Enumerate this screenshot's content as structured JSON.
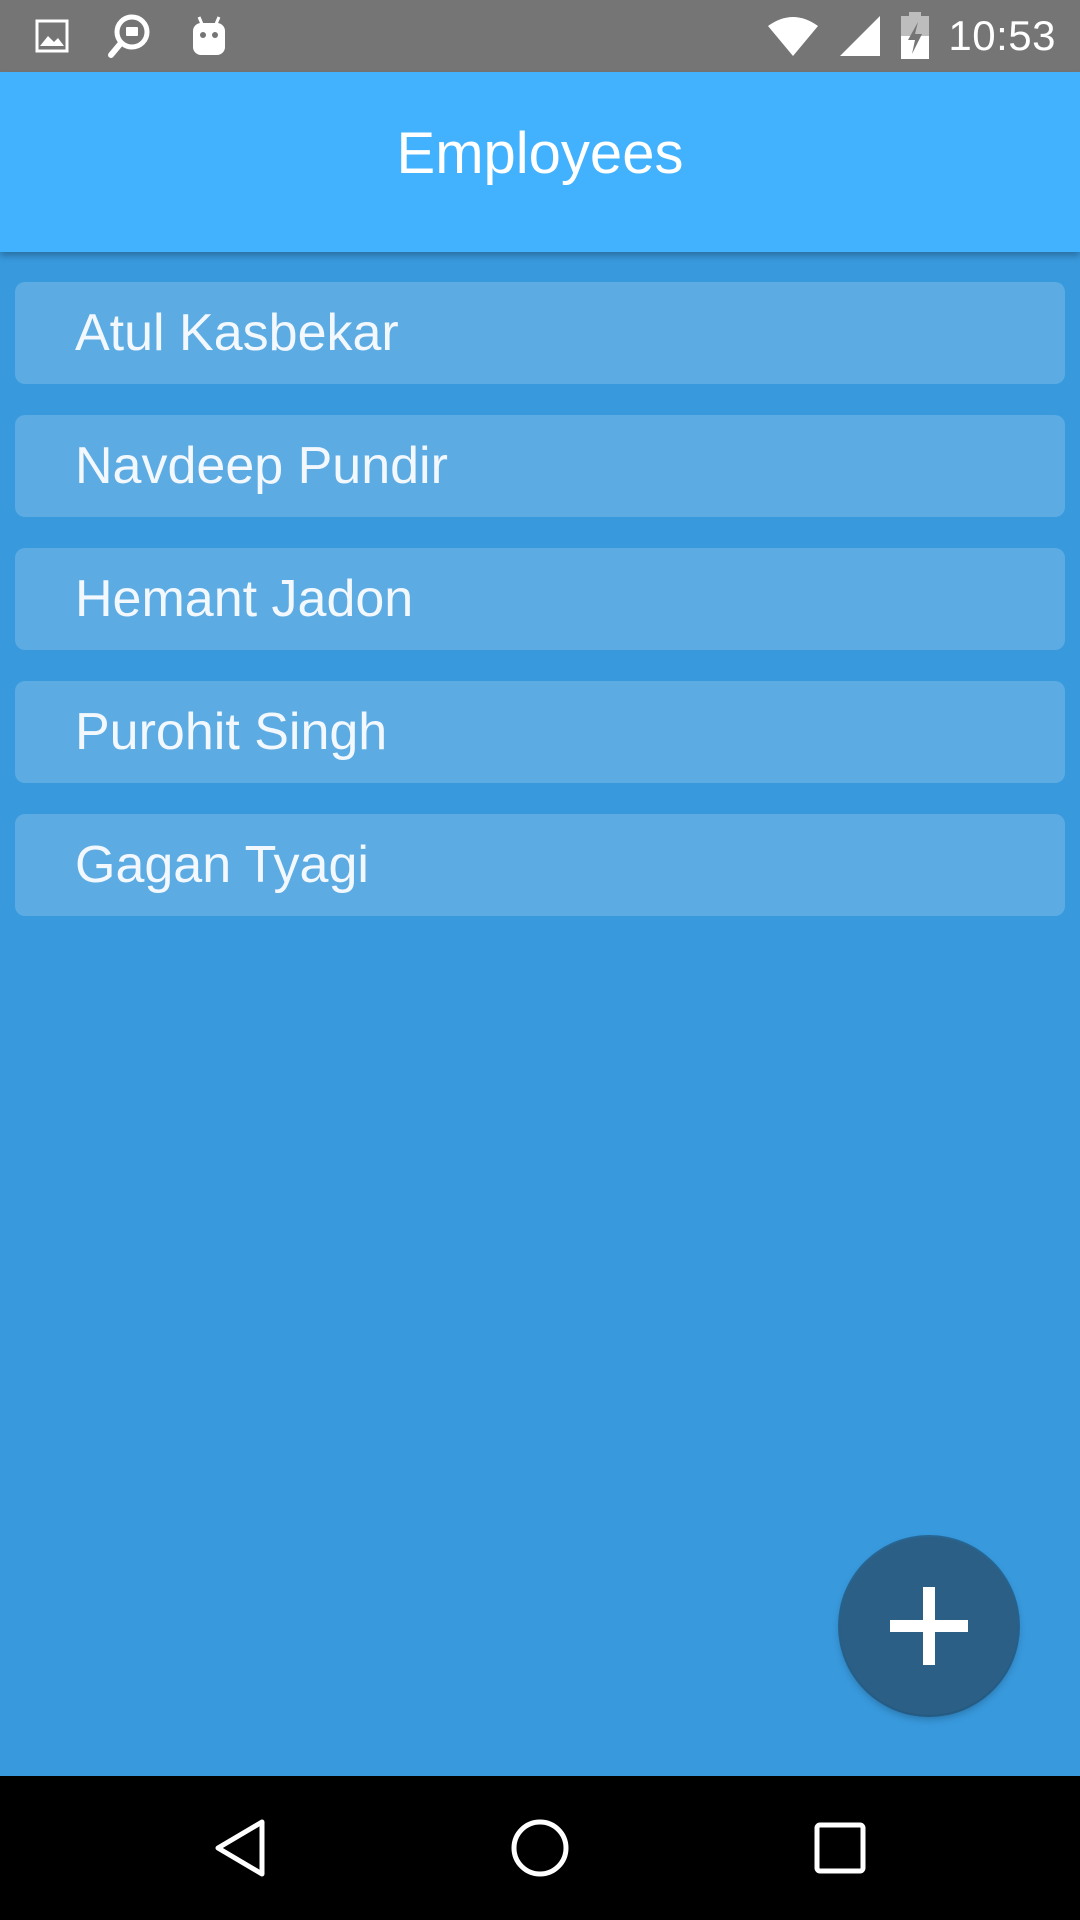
{
  "status_bar": {
    "time": "10:53",
    "left_icons": [
      "gallery-icon",
      "search-chat-icon",
      "android-icon"
    ],
    "right_icons": [
      "wifi-icon",
      "signal-icon",
      "battery-icon"
    ]
  },
  "app_bar": {
    "title": "Employees"
  },
  "employees": [
    {
      "name": "Atul Kasbekar"
    },
    {
      "name": "Navdeep Pundir"
    },
    {
      "name": "Hemant Jadon"
    },
    {
      "name": "Purohit Singh"
    },
    {
      "name": "Gagan Tyagi"
    }
  ],
  "fab": {
    "icon": "plus-icon"
  },
  "nav_bar": {
    "buttons": [
      "back-icon",
      "home-icon",
      "recents-icon"
    ]
  },
  "colors": {
    "status_bar": "#757575",
    "app_bar": "#42B2FE",
    "background": "#3899DD",
    "list_item": "#5CACE3",
    "fab": "#2C5F85",
    "nav_bar": "#000000"
  }
}
